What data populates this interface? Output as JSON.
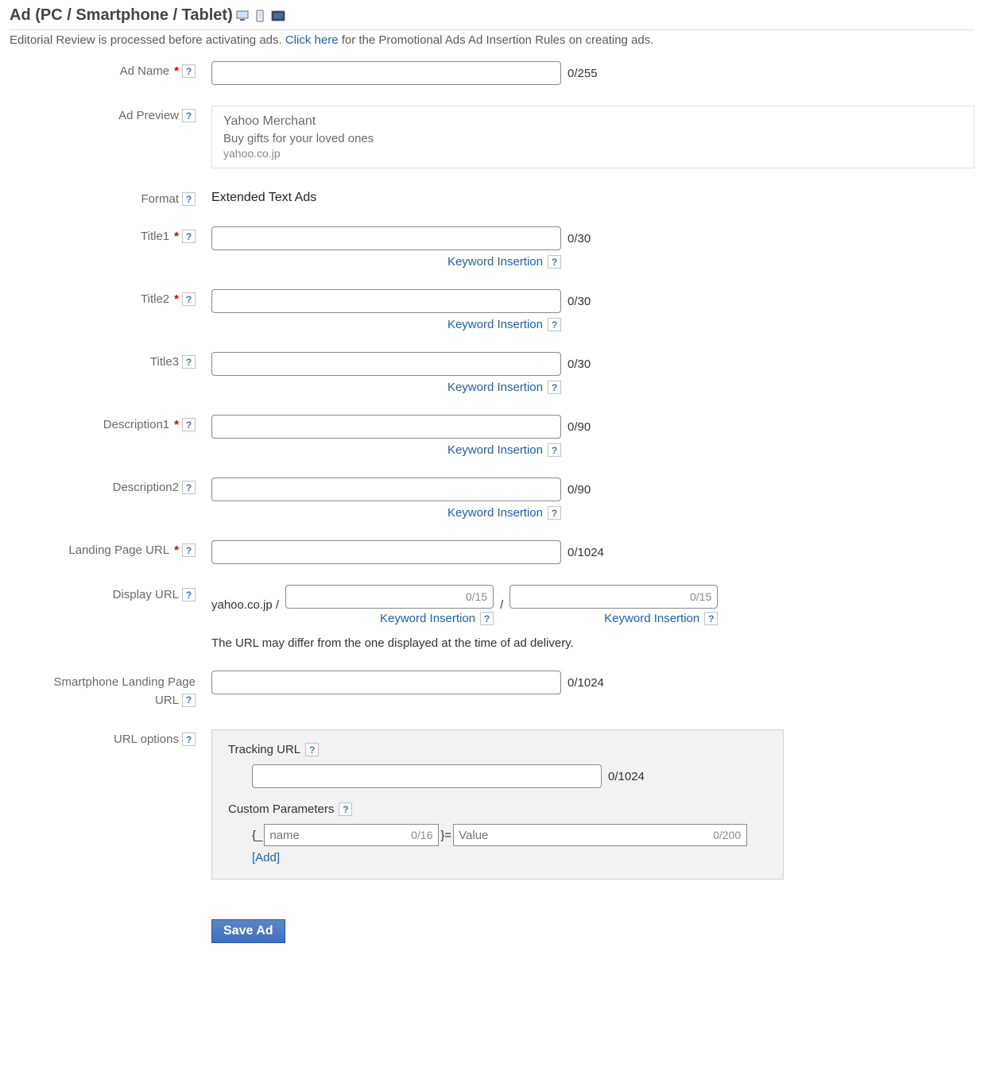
{
  "header": {
    "title": "Ad (PC / Smartphone / Tablet)",
    "subtext_pre": "Editorial Review is processed before activating ads. ",
    "click_here": "Click here",
    "subtext_post": " for the Promotional Ads Ad Insertion Rules on creating ads."
  },
  "labels": {
    "ad_name": "Ad Name",
    "ad_preview": "Ad Preview",
    "format": "Format",
    "title1": "Title1",
    "title2": "Title2",
    "title3": "Title3",
    "description1": "Description1",
    "description2": "Description2",
    "landing_page_url": "Landing Page URL",
    "display_url": "Display URL",
    "smartphone_lp_url_l1": "Smartphone Landing Page",
    "smartphone_lp_url_l2": "URL",
    "url_options": "URL options",
    "tracking_url": "Tracking URL",
    "custom_parameters": "Custom Parameters",
    "help_glyph": "?",
    "required_glyph": "*"
  },
  "preview": {
    "title": "Yahoo Merchant",
    "desc": "Buy gifts for your loved ones",
    "url": "yahoo.co.jp"
  },
  "format_value": "Extended Text Ads",
  "counters": {
    "ad_name": "0/255",
    "t30": "0/30",
    "d90": "0/90",
    "u1024": "0/1024",
    "du15": "0/15",
    "cp_name": "0/16",
    "cp_val": "0/200"
  },
  "strings": {
    "keyword_insertion": "Keyword Insertion",
    "display_url_prefix": "yahoo.co.jp /",
    "slash": "/",
    "display_url_note": "The URL may differ from the one displayed at the time of ad delivery.",
    "cp_name_ph": "name",
    "cp_val_ph": "Value",
    "brace_open": "{_",
    "brace_close": "}=",
    "add_link": "[Add]",
    "save_ad": "Save Ad"
  }
}
